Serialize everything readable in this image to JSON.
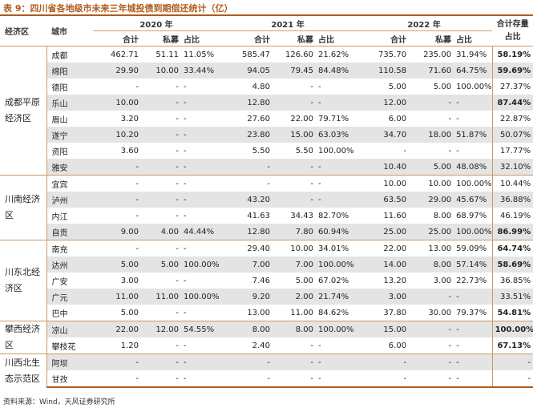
{
  "title": "表 9：四川省各地级市未来三年城投债到期偿还统计（亿）",
  "headers": {
    "region": "经济区",
    "city": "城市",
    "y2020": "2020 年",
    "y2021": "2021 年",
    "y2022": "2022 年",
    "total_share": "合计存量占比",
    "sum": "合计",
    "private": "私募",
    "ratio": "占比"
  },
  "groups": [
    {
      "region": "成都平原经济区",
      "rows": [
        [
          "成都",
          "462.71",
          "51.11",
          "11.05%",
          "585.47",
          "126.60",
          "21.62%",
          "735.70",
          "235.00",
          "31.94%",
          "58.19%"
        ],
        [
          "绵阳",
          "29.90",
          "10.00",
          "33.44%",
          "94.05",
          "79.45",
          "84.48%",
          "110.58",
          "71.60",
          "64.75%",
          "59.69%"
        ],
        [
          "德阳",
          "-",
          "-",
          "-",
          "4.80",
          "-",
          "-",
          "5.00",
          "5.00",
          "100.00%",
          "27.37%"
        ],
        [
          "乐山",
          "10.00",
          "-",
          "-",
          "12.80",
          "-",
          "-",
          "12.00",
          "-",
          "-",
          "87.44%"
        ],
        [
          "眉山",
          "3.20",
          "-",
          "-",
          "27.60",
          "22.00",
          "79.71%",
          "6.00",
          "-",
          "-",
          "22.87%"
        ],
        [
          "遂宁",
          "10.20",
          "-",
          "-",
          "23.80",
          "15.00",
          "63.03%",
          "34.70",
          "18.00",
          "51.87%",
          "50.07%"
        ],
        [
          "资阳",
          "3.60",
          "-",
          "-",
          "5.50",
          "5.50",
          "100.00%",
          "-",
          "-",
          "-",
          "17.77%"
        ],
        [
          "雅安",
          "-",
          "-",
          "-",
          "-",
          "-",
          "-",
          "10.40",
          "5.00",
          "48.08%",
          "32.10%"
        ]
      ]
    },
    {
      "region": "川南经济区",
      "rows": [
        [
          "宜宾",
          "-",
          "-",
          "-",
          "-",
          "-",
          "-",
          "10.00",
          "10.00",
          "100.00%",
          "10.44%"
        ],
        [
          "泸州",
          "-",
          "-",
          "-",
          "43.20",
          "-",
          "-",
          "63.50",
          "29.00",
          "45.67%",
          "36.88%"
        ],
        [
          "内江",
          "-",
          "-",
          "-",
          "41.63",
          "34.43",
          "82.70%",
          "11.60",
          "8.00",
          "68.97%",
          "46.19%"
        ],
        [
          "自贡",
          "9.00",
          "4.00",
          "44.44%",
          "12.80",
          "7.80",
          "60.94%",
          "25.00",
          "25.00",
          "100.00%",
          "86.99%"
        ]
      ]
    },
    {
      "region": "川东北经济区",
      "rows": [
        [
          "南充",
          "-",
          "-",
          "-",
          "29.40",
          "10.00",
          "34.01%",
          "22.00",
          "13.00",
          "59.09%",
          "64.74%"
        ],
        [
          "达州",
          "5.00",
          "5.00",
          "100.00%",
          "7.00",
          "7.00",
          "100.00%",
          "14.00",
          "8.00",
          "57.14%",
          "58.69%"
        ],
        [
          "广安",
          "3.00",
          "-",
          "-",
          "7.46",
          "5.00",
          "67.02%",
          "13.20",
          "3.00",
          "22.73%",
          "36.85%"
        ],
        [
          "广元",
          "11.00",
          "11.00",
          "100.00%",
          "9.20",
          "2.00",
          "21.74%",
          "3.00",
          "-",
          "-",
          "33.51%"
        ],
        [
          "巴中",
          "5.00",
          "-",
          "-",
          "13.00",
          "11.00",
          "84.62%",
          "37.80",
          "30.00",
          "79.37%",
          "54.81%"
        ]
      ]
    },
    {
      "region": "攀西经济区",
      "rows": [
        [
          "凉山",
          "22.00",
          "12.00",
          "54.55%",
          "8.00",
          "8.00",
          "100.00%",
          "15.00",
          "-",
          "-",
          "100.00%"
        ],
        [
          "攀枝花",
          "1.20",
          "-",
          "-",
          "2.40",
          "-",
          "-",
          "6.00",
          "-",
          "-",
          "67.13%"
        ]
      ]
    },
    {
      "region": "川西北生态示范区",
      "rows": [
        [
          "阿坝",
          "-",
          "-",
          "-",
          "-",
          "-",
          "-",
          "-",
          "-",
          "-",
          "-"
        ],
        [
          "甘孜",
          "-",
          "-",
          "-",
          "-",
          "-",
          "-",
          "-",
          "-",
          "-",
          "-"
        ]
      ]
    }
  ],
  "source": "资料来源：Wind，天风证券研究所"
}
